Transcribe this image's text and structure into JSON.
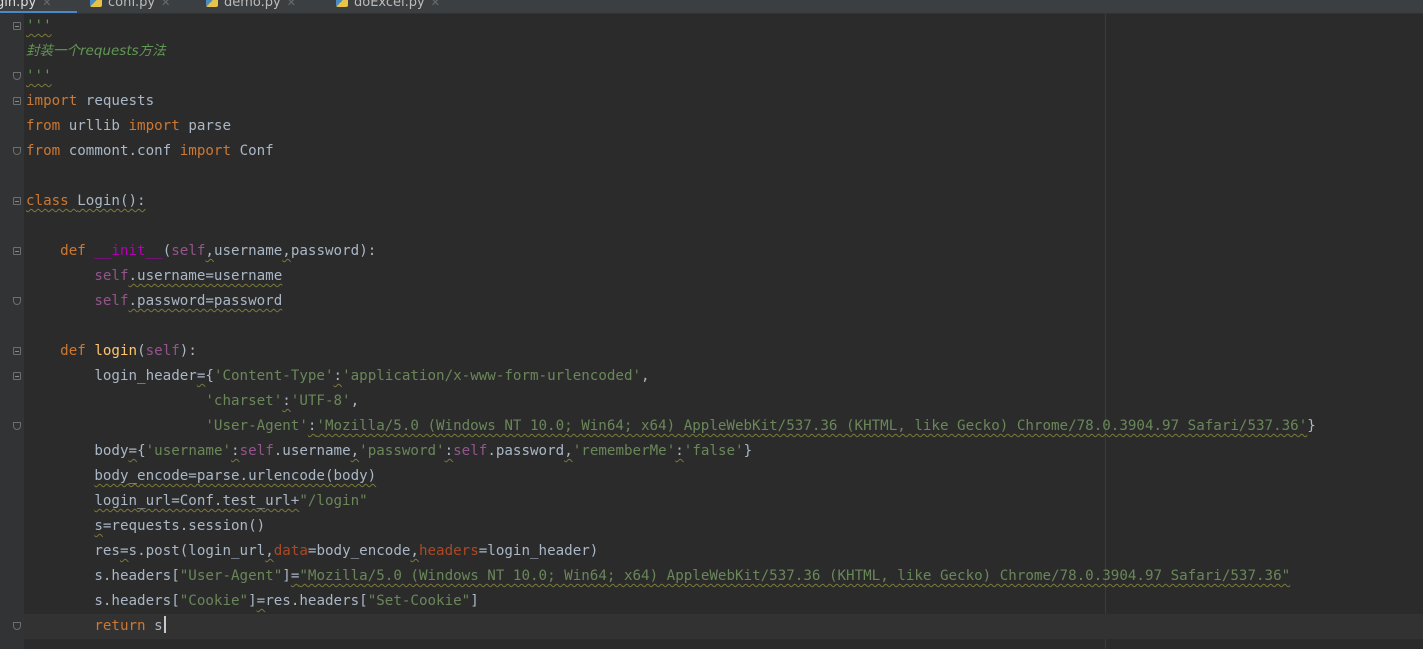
{
  "tabs": [
    {
      "label": "gin.py",
      "active": true
    },
    {
      "label": "conf.py",
      "active": false
    },
    {
      "label": "demo.py",
      "active": false
    },
    {
      "label": "doExcel.py",
      "active": false
    }
  ],
  "code": {
    "doc_open": "'''",
    "doc_comment": "封装一个requests方法",
    "doc_close": "'''",
    "line_import": [
      "import",
      "requests"
    ],
    "line_from1": [
      "from",
      "urllib",
      "import",
      "parse"
    ],
    "line_from2": [
      "from",
      "commont.conf",
      "import",
      "Conf"
    ],
    "class_kw": "class",
    "class_name": "Login():",
    "def_kw": "def",
    "init_name": "__init__",
    "self_kw": "self",
    "init_params": [
      "username",
      "password"
    ],
    "attr_username": ".username=username",
    "attr_password": ".password=password",
    "login_name": "login",
    "login_header_name": "login_header",
    "str_content_type_key": "'Content-Type'",
    "str_content_type_val": "'application/x-www-form-urlencoded'",
    "str_charset_key": "'charset'",
    "str_charset_val": "'UTF-8'",
    "str_ua_key": "'User-Agent'",
    "str_ua_val": "'Mozilla/5.0 (Windows NT 10.0; Win64; x64) AppleWebKit/537.36 (KHTML, like Gecko) Chrome/78.0.3904.97 Safari/537.36'",
    "body_name": "body",
    "str_username_key": "'username'",
    "self_username": ".username",
    "str_password_key": "'password'",
    "self_password": ".password",
    "str_remember_key": "'rememberMe'",
    "str_remember_val": "'false'",
    "body_encode_line": "body_encode=parse.urlencode(body)",
    "login_url_prefix": "login_url=Conf.test_url+",
    "str_login_path": "\"/login\"",
    "session_line": "=requests.session()",
    "s_var": "s",
    "res_var": "res",
    "post_call": ".post(login_url",
    "kw_data": "data",
    "post_data_val": "=body_encode",
    "kw_headers": "headers",
    "post_headers_val": "=login_header)",
    "s_headers_prefix": "s.headers[",
    "str_ua_key_dq": "\"User-Agent\"",
    "str_ua_val_dq": "\"Mozilla/5.0 (Windows NT 10.0; Win64; x64) AppleWebKit/537.36 (KHTML, like Gecko) Chrome/78.0.3904.97 Safari/537.36\"",
    "str_cookie_key": "\"Cookie\"",
    "res_headers_prefix": "res.headers[",
    "str_set_cookie": "\"Set-Cookie\"",
    "return_kw": "return",
    "return_val": "s"
  },
  "colors": {
    "background": "#2b2b2b",
    "keyword": "#cc7832",
    "string": "#6a8759",
    "comment": "#629755",
    "self": "#94558d",
    "identifier": "#a9b7c6"
  }
}
